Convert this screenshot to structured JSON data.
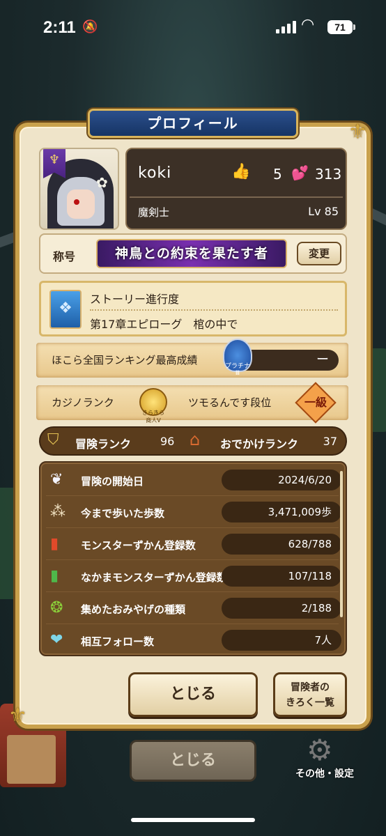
{
  "status_bar": {
    "time": "2:11",
    "battery": "71"
  },
  "panel": {
    "title": "プロフィール"
  },
  "profile": {
    "name": "koki",
    "likes": "5",
    "hearts": "313",
    "job": "魔剣士",
    "level": "Lv 85"
  },
  "title_row": {
    "label": "称号",
    "title_text": "神鳥との約束を果たす者",
    "change_button": "変更"
  },
  "story": {
    "heading": "ストーリー進行度",
    "chapter": "第17章エピローグ　棺の中で"
  },
  "hokora": {
    "label": "ほこら全国ランキング最高成績",
    "value": "ー",
    "badge": "プラチナⅢ"
  },
  "casino": {
    "label": "カジノランク",
    "badge": "きらきら商人Ⅴ",
    "rank_name": "ツモるんです段位",
    "dan": "一級"
  },
  "ranks": {
    "adventure_label": "冒険ランク",
    "adventure_value": "96",
    "outing_label": "おでかけランク",
    "outing_value": "37"
  },
  "stats": [
    {
      "icon": "wing-icon",
      "label": "冒険の開始日",
      "value": "2024/6/20"
    },
    {
      "icon": "footprints-icon",
      "label": "今まで歩いた歩数",
      "value": "3,471,009歩"
    },
    {
      "icon": "monster-book-icon",
      "label": "モンスターずかん登録数",
      "value": "628/788"
    },
    {
      "icon": "ally-book-icon",
      "label": "なかまモンスターずかん登録数",
      "value": "107/118"
    },
    {
      "icon": "souvenir-icon",
      "label": "集めたおみやげの種類",
      "value": "2/188"
    },
    {
      "icon": "handshake-icon",
      "label": "相互フォロー数",
      "value": "7人"
    }
  ],
  "buttons": {
    "close": "とじる",
    "adventurer_log": "冒険者の\nきろく一覧",
    "close_background": "とじる",
    "settings": "その他・設定"
  }
}
